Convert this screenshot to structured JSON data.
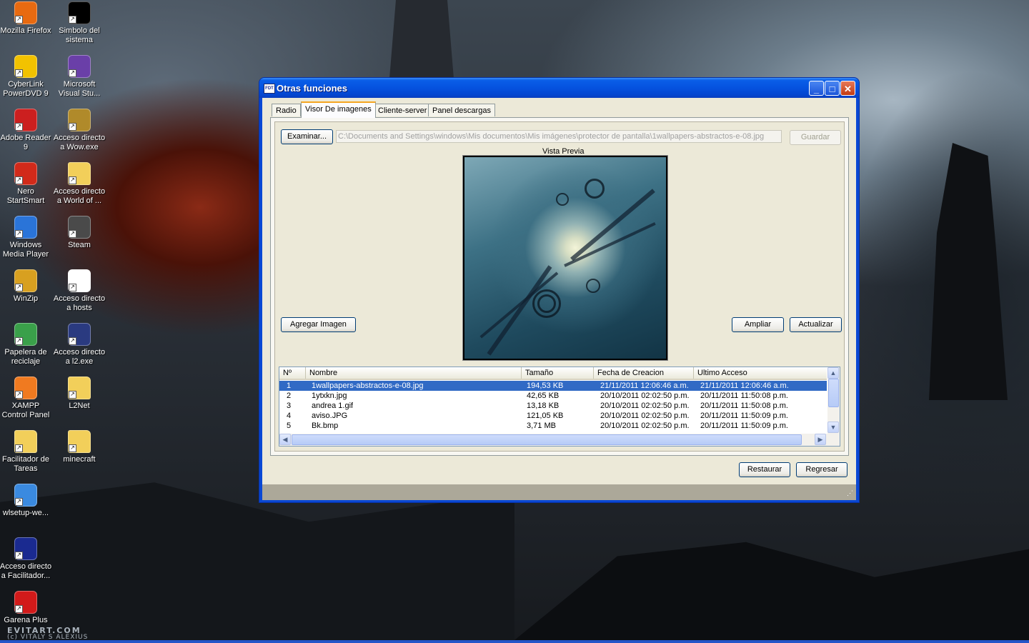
{
  "desktop": {
    "icons": [
      {
        "label": "Mozilla Firefox",
        "icon": "firefox-icon",
        "color": "#e86a10"
      },
      {
        "label": "Simbolo del sistema",
        "icon": "cmd-icon",
        "color": "#000000"
      },
      {
        "label": "CyberLink PowerDVD 9",
        "icon": "powerdvd-icon",
        "color": "#f2c200"
      },
      {
        "label": "Microsoft Visual Stu...",
        "icon": "visual-studio-icon",
        "color": "#6a3fa8"
      },
      {
        "label": "Adobe Reader 9",
        "icon": "adobe-reader-icon",
        "color": "#cc1f1f"
      },
      {
        "label": "Acceso directo a Wow.exe",
        "icon": "wow-icon",
        "color": "#b08a2a"
      },
      {
        "label": "Nero StartSmart",
        "icon": "nero-icon",
        "color": "#d22a1a"
      },
      {
        "label": "Acceso directo a World of ...",
        "icon": "folder-icon",
        "color": "#f2cf5a"
      },
      {
        "label": "Windows Media Player",
        "icon": "media-player-icon",
        "color": "#2a74d8"
      },
      {
        "label": "Steam",
        "icon": "steam-icon",
        "color": "#4a4a4a"
      },
      {
        "label": "WinZip",
        "icon": "winzip-icon",
        "color": "#d8a020"
      },
      {
        "label": "Acceso directo a hosts",
        "icon": "hosts-file-icon",
        "color": "#ffffff"
      },
      {
        "label": "Papelera de reciclaje",
        "icon": "recycle-bin-icon",
        "color": "#3aa04a"
      },
      {
        "label": "Acceso directo a l2.exe",
        "icon": "l2-icon",
        "color": "#2a3a80"
      },
      {
        "label": "XAMPP Control Panel",
        "icon": "xampp-icon",
        "color": "#f07a20"
      },
      {
        "label": "L2Net",
        "icon": "folder-icon",
        "color": "#f2cf5a"
      },
      {
        "label": "Facilitador de Tareas",
        "icon": "folder-icon",
        "color": "#f2cf5a"
      },
      {
        "label": "minecraft",
        "icon": "folder-icon",
        "color": "#f2cf5a"
      },
      {
        "label": "wlsetup-we...",
        "icon": "windows-logo-icon",
        "color": "#3a8ae0"
      },
      {
        "label": "Acceso directo a Facilitador...",
        "icon": "fdt-icon",
        "color": "#1a2a90"
      },
      {
        "label": "Garena Plus",
        "icon": "garena-icon",
        "color": "#d21a1a"
      }
    ],
    "wallpaper_credit": "EVITART.COM",
    "wallpaper_author": "(c) VITALY S ALEXIUS"
  },
  "window": {
    "title": "Otras funciones",
    "app_icon_text": "FDT",
    "controls": {
      "minimize": "_",
      "maximize": "□",
      "close": "✕"
    },
    "tabs": [
      {
        "label": "Radio",
        "active": false
      },
      {
        "label": "Visor De imagenes",
        "active": true
      },
      {
        "label": "Cliente-server",
        "active": false
      },
      {
        "label": "Panel descargas",
        "active": false
      }
    ],
    "viewer": {
      "browse_button": "Examinar...",
      "path_value": "C:\\Documents and Settings\\windows\\Mis documentos\\Mis imágenes\\protector de pantalla\\1wallpapers-abstractos-e-08.jpg",
      "save_button": "Guardar",
      "preview_label": "Vista Previa",
      "add_image_button": "Agregar Imagen",
      "enlarge_button": "Ampliar",
      "refresh_button": "Actualizar"
    },
    "file_list": {
      "columns": [
        "Nº",
        "Nombre",
        "Tamaño",
        "Fecha de Creacion",
        "Ultimo Acceso"
      ],
      "rows": [
        {
          "n": "1",
          "name": "1wallpapers-abstractos-e-08.jpg",
          "size": "194,53 KB",
          "created": "21/11/2011 12:06:46 a.m.",
          "accessed": "21/11/2011 12:06:46 a.m.",
          "selected": true
        },
        {
          "n": "2",
          "name": "1ytxkn.jpg",
          "size": "42,65 KB",
          "created": "20/10/2011 02:02:50 p.m.",
          "accessed": "20/11/2011 11:50:08 p.m.",
          "selected": false
        },
        {
          "n": "3",
          "name": "andrea 1.gif",
          "size": "13,18 KB",
          "created": "20/10/2011 02:02:50 p.m.",
          "accessed": "20/11/2011 11:50:08 p.m.",
          "selected": false
        },
        {
          "n": "4",
          "name": "aviso.JPG",
          "size": "121,05 KB",
          "created": "20/10/2011 02:02:50 p.m.",
          "accessed": "20/11/2011 11:50:09 p.m.",
          "selected": false
        },
        {
          "n": "5",
          "name": "Bk.bmp",
          "size": "3,71 MB",
          "created": "20/10/2011 02:02:50 p.m.",
          "accessed": "20/11/2011 11:50:09 p.m.",
          "selected": false
        }
      ]
    },
    "footer": {
      "restore_button": "Restaurar",
      "back_button": "Regresar"
    }
  },
  "colors": {
    "selection": "#316ac5",
    "title_bar": "#0a5ee8",
    "window_face": "#ece9d8",
    "tab_highlight": "#f5a623"
  }
}
